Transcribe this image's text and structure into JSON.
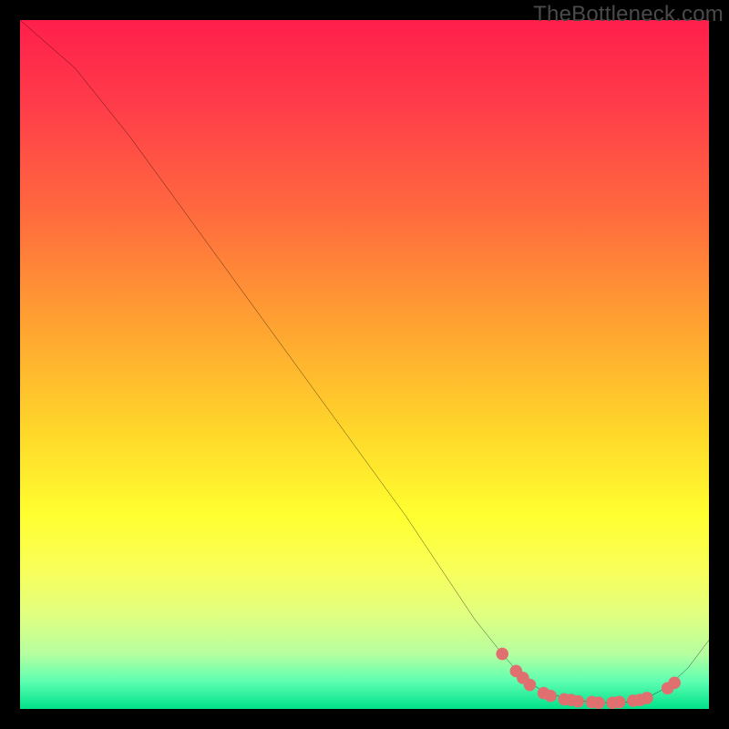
{
  "watermark": "TheBottleneck.com",
  "chart_data": {
    "type": "line",
    "title": "",
    "xlabel": "",
    "ylabel": "",
    "xlim": [
      0,
      100
    ],
    "ylim": [
      0,
      100
    ],
    "grid": false,
    "legend": false,
    "series": [
      {
        "name": "curve",
        "color": "#000000",
        "x": [
          0,
          8,
          16,
          24,
          32,
          40,
          48,
          56,
          62,
          66,
          70,
          73,
          76,
          80,
          84,
          88,
          91,
          94,
          97,
          100
        ],
        "y": [
          100,
          93,
          83,
          72,
          61,
          50,
          39,
          28,
          19,
          13,
          8,
          4.5,
          2.5,
          1.3,
          0.9,
          1.0,
          1.6,
          3.2,
          6.0,
          10.0
        ]
      }
    ],
    "markers": [
      {
        "x": 70,
        "y": 8.0,
        "color": "#e07070"
      },
      {
        "x": 72,
        "y": 5.5,
        "color": "#e07070"
      },
      {
        "x": 73,
        "y": 4.5,
        "color": "#e07070"
      },
      {
        "x": 74,
        "y": 3.5,
        "color": "#e07070"
      },
      {
        "x": 76,
        "y": 2.3,
        "color": "#e07070"
      },
      {
        "x": 77,
        "y": 1.9,
        "color": "#e07070"
      },
      {
        "x": 79,
        "y": 1.4,
        "color": "#e07070"
      },
      {
        "x": 80,
        "y": 1.3,
        "color": "#e07070"
      },
      {
        "x": 81,
        "y": 1.1,
        "color": "#e07070"
      },
      {
        "x": 83,
        "y": 1.0,
        "color": "#e07070"
      },
      {
        "x": 84,
        "y": 0.9,
        "color": "#e07070"
      },
      {
        "x": 86,
        "y": 0.9,
        "color": "#e07070"
      },
      {
        "x": 87,
        "y": 1.0,
        "color": "#e07070"
      },
      {
        "x": 89,
        "y": 1.2,
        "color": "#e07070"
      },
      {
        "x": 90,
        "y": 1.3,
        "color": "#e07070"
      },
      {
        "x": 91,
        "y": 1.6,
        "color": "#e07070"
      },
      {
        "x": 94,
        "y": 3.0,
        "color": "#e07070"
      },
      {
        "x": 95,
        "y": 3.8,
        "color": "#e07070"
      }
    ],
    "background_gradient": {
      "direction": "vertical",
      "stops": [
        {
          "pos": 0.0,
          "color": "#ff1f4b"
        },
        {
          "pos": 0.45,
          "color": "#ffa531"
        },
        {
          "pos": 0.72,
          "color": "#ffff30"
        },
        {
          "pos": 1.0,
          "color": "#00e18a"
        }
      ]
    }
  }
}
